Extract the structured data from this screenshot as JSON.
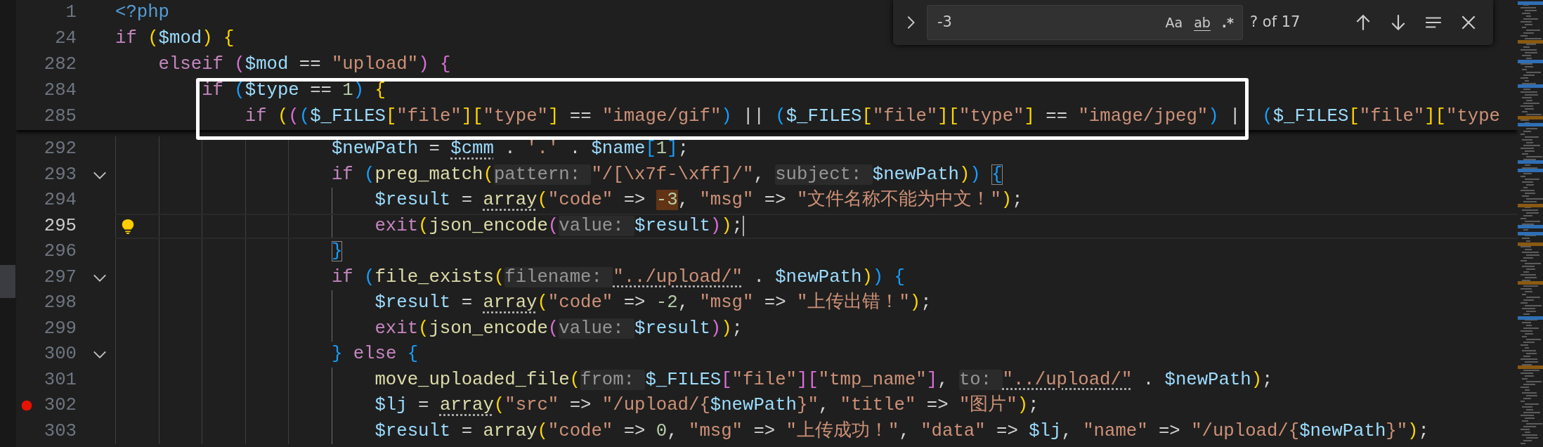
{
  "find_widget": {
    "query": "-3",
    "options": [
      {
        "kind": "case",
        "label": "Aa",
        "selected": false
      },
      {
        "kind": "word",
        "label": "ab",
        "selected": false
      },
      {
        "kind": "regex",
        "label": ".*",
        "selected": false
      }
    ],
    "result": "? of 17"
  },
  "sticky_lines": [
    {
      "number": "1",
      "tokens": [
        {
          "text": "<?php",
          "kind": "tag"
        }
      ]
    },
    {
      "number": "24",
      "tokens": [
        {
          "text": "if ",
          "kind": "kw"
        },
        {
          "text": "(",
          "kind": "b1"
        },
        {
          "text": "$mod",
          "kind": "var"
        },
        {
          "text": ") {",
          "kind": "b1"
        }
      ]
    },
    {
      "number": "282",
      "tokens": [
        {
          "text": "    elseif ",
          "kind": "kw"
        },
        {
          "text": "(",
          "kind": "b2"
        },
        {
          "text": "$mod",
          "kind": "var"
        },
        {
          "text": " == ",
          "kind": "op"
        },
        {
          "text": "\"upload\"",
          "kind": "str"
        },
        {
          "text": ") {",
          "kind": "b2"
        }
      ]
    },
    {
      "number": "284",
      "tokens": [
        {
          "text": "        if ",
          "kind": "kw"
        },
        {
          "text": "(",
          "kind": "b3"
        },
        {
          "text": "$type",
          "kind": "var"
        },
        {
          "text": " == ",
          "kind": "op"
        },
        {
          "text": "1",
          "kind": "num"
        },
        {
          "text": ")",
          "kind": "b3"
        },
        {
          "text": " {",
          "kind": "b1"
        }
      ]
    },
    {
      "number": "285",
      "tokens": [
        {
          "text": "            if ",
          "kind": "kw"
        },
        {
          "text": "(",
          "kind": "b1"
        },
        {
          "text": "(",
          "kind": "b2"
        },
        {
          "text": "(",
          "kind": "b3"
        },
        {
          "text": "$_FILES",
          "kind": "var"
        },
        {
          "text": "[",
          "kind": "b1"
        },
        {
          "text": "\"file\"",
          "kind": "str"
        },
        {
          "text": "][",
          "kind": "b1"
        },
        {
          "text": "\"type\"",
          "kind": "str"
        },
        {
          "text": "]",
          "kind": "b1"
        },
        {
          "text": " == ",
          "kind": "op"
        },
        {
          "text": "\"image/gif\"",
          "kind": "str"
        },
        {
          "text": ")",
          "kind": "b3"
        },
        {
          "text": " || ",
          "kind": "op"
        },
        {
          "text": "(",
          "kind": "b3"
        },
        {
          "text": "$_FILES",
          "kind": "var"
        },
        {
          "text": "[",
          "kind": "b1"
        },
        {
          "text": "\"file\"",
          "kind": "str"
        },
        {
          "text": "][",
          "kind": "b1"
        },
        {
          "text": "\"type\"",
          "kind": "str"
        },
        {
          "text": "]",
          "kind": "b1"
        },
        {
          "text": " == ",
          "kind": "op"
        },
        {
          "text": "\"image/jpeg\"",
          "kind": "str"
        },
        {
          "text": ")",
          "kind": "b3"
        },
        {
          "text": " || ",
          "kind": "op"
        },
        {
          "text": "(",
          "kind": "b3"
        },
        {
          "text": "$_FILES",
          "kind": "var"
        },
        {
          "text": "[",
          "kind": "b1"
        },
        {
          "text": "\"file\"",
          "kind": "str"
        },
        {
          "text": "][",
          "kind": "b1"
        },
        {
          "text": "\"type",
          "kind": "str"
        }
      ]
    }
  ],
  "lines": [
    {
      "number": "292",
      "current": false,
      "foldable": false,
      "breakpoint": false,
      "lightbulb": false,
      "tokens": [
        {
          "text": "                    $newPath",
          "kind": "var"
        },
        {
          "text": " = ",
          "kind": "op"
        },
        {
          "text": "$cmm",
          "kind": "var",
          "dotted": true
        },
        {
          "text": " . ",
          "kind": "op"
        },
        {
          "text": "'.'",
          "kind": "str"
        },
        {
          "text": " . ",
          "kind": "op"
        },
        {
          "text": "$name",
          "kind": "var"
        },
        {
          "text": "[",
          "kind": "b3"
        },
        {
          "text": "1",
          "kind": "num"
        },
        {
          "text": "]",
          "kind": "b3"
        },
        {
          "text": ";",
          "kind": "op"
        }
      ]
    },
    {
      "number": "293",
      "current": false,
      "foldable": true,
      "breakpoint": false,
      "lightbulb": false,
      "tokens": [
        {
          "text": "                    if ",
          "kind": "kw"
        },
        {
          "text": "(",
          "kind": "b3"
        },
        {
          "text": "preg_match",
          "kind": "fn"
        },
        {
          "text": "(",
          "kind": "b1"
        },
        {
          "text": "pattern: ",
          "kind": "hint"
        },
        {
          "text": "\"/[\\x7f-\\xff]/\"",
          "kind": "str"
        },
        {
          "text": ", ",
          "kind": "op"
        },
        {
          "text": "subject: ",
          "kind": "hint"
        },
        {
          "text": "$newPath",
          "kind": "var"
        },
        {
          "text": ")",
          "kind": "b1"
        },
        {
          "text": ") ",
          "kind": "b3"
        },
        {
          "text": "{",
          "kind": "b3",
          "boxed": true
        }
      ]
    },
    {
      "number": "294",
      "current": false,
      "foldable": false,
      "breakpoint": false,
      "lightbulb": false,
      "tokens": [
        {
          "text": "                        $result",
          "kind": "var"
        },
        {
          "text": " = ",
          "kind": "op"
        },
        {
          "text": "array",
          "kind": "fn",
          "dotted": true
        },
        {
          "text": "(",
          "kind": "b1"
        },
        {
          "text": "\"code\"",
          "kind": "str"
        },
        {
          "text": " => ",
          "kind": "op"
        },
        {
          "text": "-3",
          "kind": "match"
        },
        {
          "text": ", ",
          "kind": "op"
        },
        {
          "text": "\"msg\"",
          "kind": "str"
        },
        {
          "text": " => ",
          "kind": "op"
        },
        {
          "text": "\"文件名称不能为中文！\"",
          "kind": "str"
        },
        {
          "text": ")",
          "kind": "b1"
        },
        {
          "text": ";",
          "kind": "op"
        }
      ]
    },
    {
      "number": "295",
      "current": true,
      "foldable": false,
      "breakpoint": false,
      "lightbulb": true,
      "tokens": [
        {
          "text": "                        exit",
          "kind": "kw"
        },
        {
          "text": "(",
          "kind": "b1"
        },
        {
          "text": "json_encode",
          "kind": "fn"
        },
        {
          "text": "(",
          "kind": "b2"
        },
        {
          "text": "value: ",
          "kind": "hint"
        },
        {
          "text": "$result",
          "kind": "var"
        },
        {
          "text": ")",
          "kind": "b2"
        },
        {
          "text": ")",
          "kind": "b1"
        },
        {
          "text": ";",
          "kind": "op"
        }
      ]
    },
    {
      "number": "296",
      "current": false,
      "foldable": false,
      "breakpoint": false,
      "lightbulb": false,
      "tokens": [
        {
          "text": "                    }",
          "kind": "b3",
          "boxed": true
        }
      ]
    },
    {
      "number": "297",
      "current": false,
      "foldable": true,
      "breakpoint": false,
      "lightbulb": false,
      "tokens": [
        {
          "text": "                    if ",
          "kind": "kw"
        },
        {
          "text": "(",
          "kind": "b3"
        },
        {
          "text": "file_exists",
          "kind": "fn"
        },
        {
          "text": "(",
          "kind": "b1"
        },
        {
          "text": "filename: ",
          "kind": "hint"
        },
        {
          "text": "\"../upload/\"",
          "kind": "str",
          "dotted": true
        },
        {
          "text": " . ",
          "kind": "op"
        },
        {
          "text": "$newPath",
          "kind": "var"
        },
        {
          "text": ")",
          "kind": "b1"
        },
        {
          "text": ") {",
          "kind": "b3"
        }
      ]
    },
    {
      "number": "298",
      "current": false,
      "foldable": false,
      "breakpoint": false,
      "lightbulb": false,
      "tokens": [
        {
          "text": "                        $result",
          "kind": "var"
        },
        {
          "text": " = ",
          "kind": "op"
        },
        {
          "text": "array",
          "kind": "fn",
          "dotted": true
        },
        {
          "text": "(",
          "kind": "b1"
        },
        {
          "text": "\"code\"",
          "kind": "str"
        },
        {
          "text": " => ",
          "kind": "op"
        },
        {
          "text": "-2",
          "kind": "num"
        },
        {
          "text": ", ",
          "kind": "op"
        },
        {
          "text": "\"msg\"",
          "kind": "str"
        },
        {
          "text": " => ",
          "kind": "op"
        },
        {
          "text": "\"上传出错！\"",
          "kind": "str"
        },
        {
          "text": ")",
          "kind": "b1"
        },
        {
          "text": ";",
          "kind": "op"
        }
      ]
    },
    {
      "number": "299",
      "current": false,
      "foldable": false,
      "breakpoint": false,
      "lightbulb": false,
      "tokens": [
        {
          "text": "                        exit",
          "kind": "kw"
        },
        {
          "text": "(",
          "kind": "b1"
        },
        {
          "text": "json_encode",
          "kind": "fn"
        },
        {
          "text": "(",
          "kind": "b2"
        },
        {
          "text": "value: ",
          "kind": "hint"
        },
        {
          "text": "$result",
          "kind": "var"
        },
        {
          "text": ")",
          "kind": "b2"
        },
        {
          "text": ")",
          "kind": "b1"
        },
        {
          "text": ";",
          "kind": "op"
        }
      ]
    },
    {
      "number": "300",
      "current": false,
      "foldable": true,
      "breakpoint": false,
      "lightbulb": false,
      "tokens": [
        {
          "text": "                    } ",
          "kind": "b3"
        },
        {
          "text": "else ",
          "kind": "kw"
        },
        {
          "text": "{",
          "kind": "b3"
        }
      ]
    },
    {
      "number": "301",
      "current": false,
      "foldable": false,
      "breakpoint": false,
      "lightbulb": false,
      "tokens": [
        {
          "text": "                        move_uploaded_file",
          "kind": "fn"
        },
        {
          "text": "(",
          "kind": "b1"
        },
        {
          "text": "from: ",
          "kind": "hint"
        },
        {
          "text": "$_FILES",
          "kind": "var"
        },
        {
          "text": "[",
          "kind": "b2"
        },
        {
          "text": "\"file\"",
          "kind": "str"
        },
        {
          "text": "][",
          "kind": "b2"
        },
        {
          "text": "\"tmp_name\"",
          "kind": "str"
        },
        {
          "text": "]",
          "kind": "b2"
        },
        {
          "text": ", ",
          "kind": "op"
        },
        {
          "text": "to: ",
          "kind": "hint"
        },
        {
          "text": "\"../upload/\"",
          "kind": "str",
          "dotted": true
        },
        {
          "text": " . ",
          "kind": "op"
        },
        {
          "text": "$newPath",
          "kind": "var"
        },
        {
          "text": ")",
          "kind": "b1"
        },
        {
          "text": ";",
          "kind": "op"
        }
      ]
    },
    {
      "number": "302",
      "current": false,
      "foldable": false,
      "breakpoint": true,
      "lightbulb": false,
      "tokens": [
        {
          "text": "                        $lj",
          "kind": "var"
        },
        {
          "text": " = ",
          "kind": "op"
        },
        {
          "text": "array",
          "kind": "fn",
          "dotted": true
        },
        {
          "text": "(",
          "kind": "b1"
        },
        {
          "text": "\"src\"",
          "kind": "str"
        },
        {
          "text": " => ",
          "kind": "op"
        },
        {
          "text": "\"/upload/{",
          "kind": "str"
        },
        {
          "text": "$newPath",
          "kind": "var"
        },
        {
          "text": "}\"",
          "kind": "str"
        },
        {
          "text": ", ",
          "kind": "op"
        },
        {
          "text": "\"title\"",
          "kind": "str"
        },
        {
          "text": " => ",
          "kind": "op"
        },
        {
          "text": "\"图片\"",
          "kind": "str"
        },
        {
          "text": ")",
          "kind": "b1"
        },
        {
          "text": ";",
          "kind": "op"
        }
      ]
    },
    {
      "number": "303",
      "current": false,
      "foldable": false,
      "breakpoint": false,
      "lightbulb": false,
      "tokens": [
        {
          "text": "                        $result",
          "kind": "var"
        },
        {
          "text": " = ",
          "kind": "op"
        },
        {
          "text": "array",
          "kind": "fn"
        },
        {
          "text": "(",
          "kind": "b1"
        },
        {
          "text": "\"code\"",
          "kind": "str"
        },
        {
          "text": " => ",
          "kind": "op"
        },
        {
          "text": "0",
          "kind": "num"
        },
        {
          "text": ", ",
          "kind": "op"
        },
        {
          "text": "\"msg\"",
          "kind": "str"
        },
        {
          "text": " => ",
          "kind": "op"
        },
        {
          "text": "\"上传成功！\"",
          "kind": "str"
        },
        {
          "text": ", ",
          "kind": "op"
        },
        {
          "text": "\"data\"",
          "kind": "str"
        },
        {
          "text": " => ",
          "kind": "op"
        },
        {
          "text": "$lj",
          "kind": "var"
        },
        {
          "text": ", ",
          "kind": "op"
        },
        {
          "text": "\"name\"",
          "kind": "str"
        },
        {
          "text": " => ",
          "kind": "op"
        },
        {
          "text": "\"/upload/{",
          "kind": "str"
        },
        {
          "text": "$newPath",
          "kind": "var"
        },
        {
          "text": "}\"",
          "kind": "str"
        },
        {
          "text": ")",
          "kind": "b1"
        },
        {
          "text": ";",
          "kind": "op"
        }
      ]
    }
  ]
}
